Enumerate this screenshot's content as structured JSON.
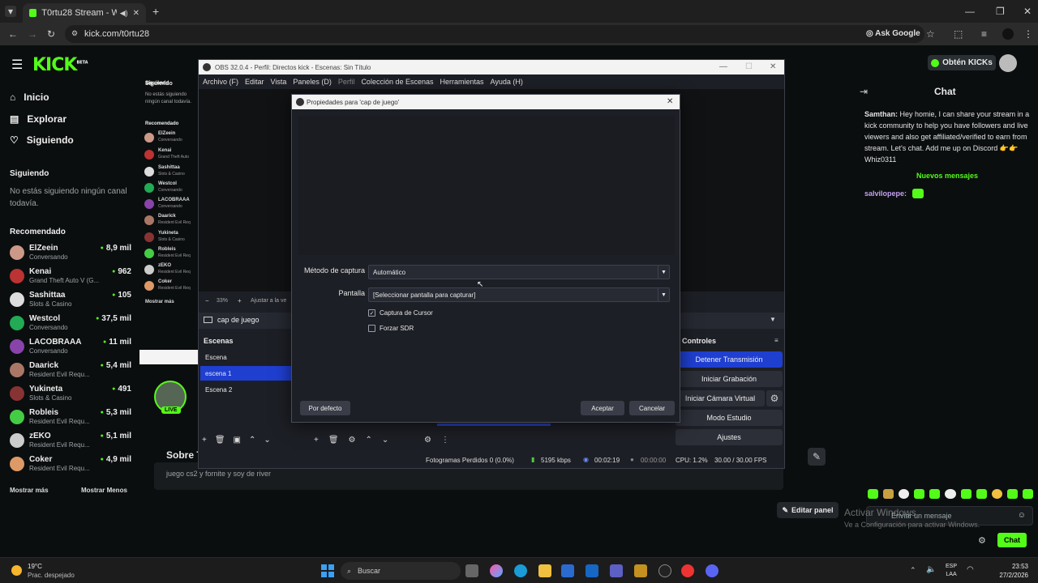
{
  "browser": {
    "tab_title": "T0rtu28 Stream - Watch Li",
    "new_tab": "+",
    "url": "kick.com/t0rtu28",
    "ask_google": "Ask Google"
  },
  "kick": {
    "logo": "KICK",
    "logo_beta": "BETA",
    "nav": [
      {
        "label": "Inicio",
        "icon": "home-icon"
      },
      {
        "label": "Explorar",
        "icon": "browse-icon"
      },
      {
        "label": "Siguiendo",
        "icon": "heart-icon"
      }
    ],
    "following_title": "Siguiendo",
    "following_empty": "No estás siguiendo ningún canal todavía.",
    "recommended_title": "Recomendado",
    "recommended": [
      {
        "name": "ElZeein",
        "category": "Conversando",
        "viewers": "8,9 mil"
      },
      {
        "name": "Kenai",
        "category": "Grand Theft Auto V (G...",
        "viewers": "962"
      },
      {
        "name": "Sashittaa",
        "category": "Slots & Casino",
        "viewers": "105"
      },
      {
        "name": "Westcol",
        "category": "Conversando",
        "viewers": "37,5 mil"
      },
      {
        "name": "LACOBRAAA",
        "category": "Conversando",
        "viewers": "11 mil"
      },
      {
        "name": "Daarick",
        "category": "Resident Evil Requ...",
        "viewers": "5,4 mil"
      },
      {
        "name": "Yukineta",
        "category": "Slots & Casino",
        "viewers": "491"
      },
      {
        "name": "Robleis",
        "category": "Resident Evil Requ...",
        "viewers": "5,3 mil"
      },
      {
        "name": "zEKO",
        "category": "Resident Evil Requ...",
        "viewers": "5,1 mil"
      },
      {
        "name": "Coker",
        "category": "Resident Evil Requ...",
        "viewers": "4,9 mil"
      }
    ],
    "show_more": "Mostrar más",
    "show_less": "Mostrar Menos",
    "obtain_kicks": "Obtén KICKs",
    "about_title": "Sobre T",
    "about_text": "juego cs2 y fornite y soy de river",
    "edit_panel": "Editar panel",
    "live_badge": "LIVE"
  },
  "chat": {
    "title": "Chat",
    "messages": [
      {
        "user": "Samthan",
        "text": "Hey homie, I can share your stream in a kick community to help you have followers and live viewers and also get affiliated/verified to earn from stream. Let's chat. Add me up on Discord 👉👉 Whiz0311"
      }
    ],
    "new_messages": "Nuevos mensajes",
    "last_user": "salvilopepe:",
    "input_placeholder": "Enviar un mensaje",
    "send_button": "Chat",
    "activate_title": "Activar Windows",
    "activate_sub": "Ve a Configuración para activar Windows."
  },
  "obs": {
    "title": "OBS 32.0.4 - Perfil: Directos kick - Escenas: Sin Título",
    "menu": [
      "Archivo (F)",
      "Editar",
      "Vista",
      "Paneles (D)",
      "Perfil",
      "Colección de Escenas",
      "Herramientas",
      "Ayuda (H)"
    ],
    "left_mini": {
      "following_title": "Siguiendo",
      "following_text": "No estás siguiendo ningún canal todavía.",
      "rec_title": "Recomendado",
      "show_more": "Mostrar más"
    },
    "source_name": "cap de juego",
    "zoom": "33%",
    "fit": "Ajustar a la ve",
    "scenes_title": "Escenas",
    "scenes": [
      "Escena",
      "escena 1",
      "Escena 2"
    ],
    "controls_title": "Controles",
    "controls": [
      "Detener Transmisión",
      "Iniciar Grabación",
      "Iniciar Cámara Virtual",
      "Modo Estudio",
      "Ajustes"
    ],
    "status": {
      "dropped": "Fotogramas Perdidos 0 (0.0%)",
      "bitrate": "5195 kbps",
      "live_time": "00:02:19",
      "rec_time": "00:00:00",
      "cpu": "CPU: 1.2%",
      "fps": "30.00 / 30.00 FPS"
    }
  },
  "dialog": {
    "title": "Propiedades para 'cap de juego'",
    "capture_method_label": "Método de captura",
    "capture_method_value": "Automático",
    "screen_label": "Pantalla",
    "screen_value": "[Seleccionar pantalla para capturar]",
    "cursor_label": "Captura de Cursor",
    "cursor_checked": true,
    "sdr_label": "Forzar SDR",
    "sdr_checked": false,
    "defaults_button": "Por defecto",
    "ok_button": "Aceptar",
    "cancel_button": "Cancelar"
  },
  "taskbar": {
    "weather_temp": "19°C",
    "weather_desc": "Prac. despejado",
    "search": "Buscar",
    "lang_top": "ESP",
    "lang_bottom": "LAA",
    "time": "23:53",
    "date": "27/2/2026"
  },
  "colors": {
    "kick_green": "#53fc18",
    "obs_bg": "#1d1f26",
    "obs_selected": "#1f3fd1",
    "stop_stream": "#1f3fd1"
  }
}
